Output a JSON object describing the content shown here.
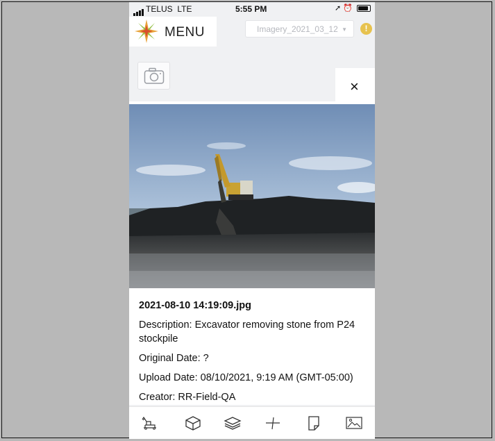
{
  "status_bar": {
    "carrier": "TELUS",
    "network": "LTE",
    "time": "5:55 PM"
  },
  "header": {
    "menu_label": "MENU",
    "imagery_select": "Imagery_2021_03_12"
  },
  "alert": {
    "label": "!"
  },
  "close_label": "×",
  "photo_details": {
    "filename": "2021-08-10 14:19:09.jpg",
    "description": "Description: Excavator removing stone from P24 stockpile",
    "original_date": "Original Date: ?",
    "upload_date": "Upload Date: 08/10/2021, 9:19 AM (GMT-05:00)",
    "creator": "Creator: RR-Field-QA"
  },
  "colors": {
    "background": "#b8b8b8",
    "app_bg": "#f0f1f3",
    "alert": "#e7c24e"
  },
  "toolbar_icons": [
    "excavator-icon",
    "cube-icon",
    "layers-icon",
    "measure-icon",
    "note-icon",
    "image-icon"
  ]
}
